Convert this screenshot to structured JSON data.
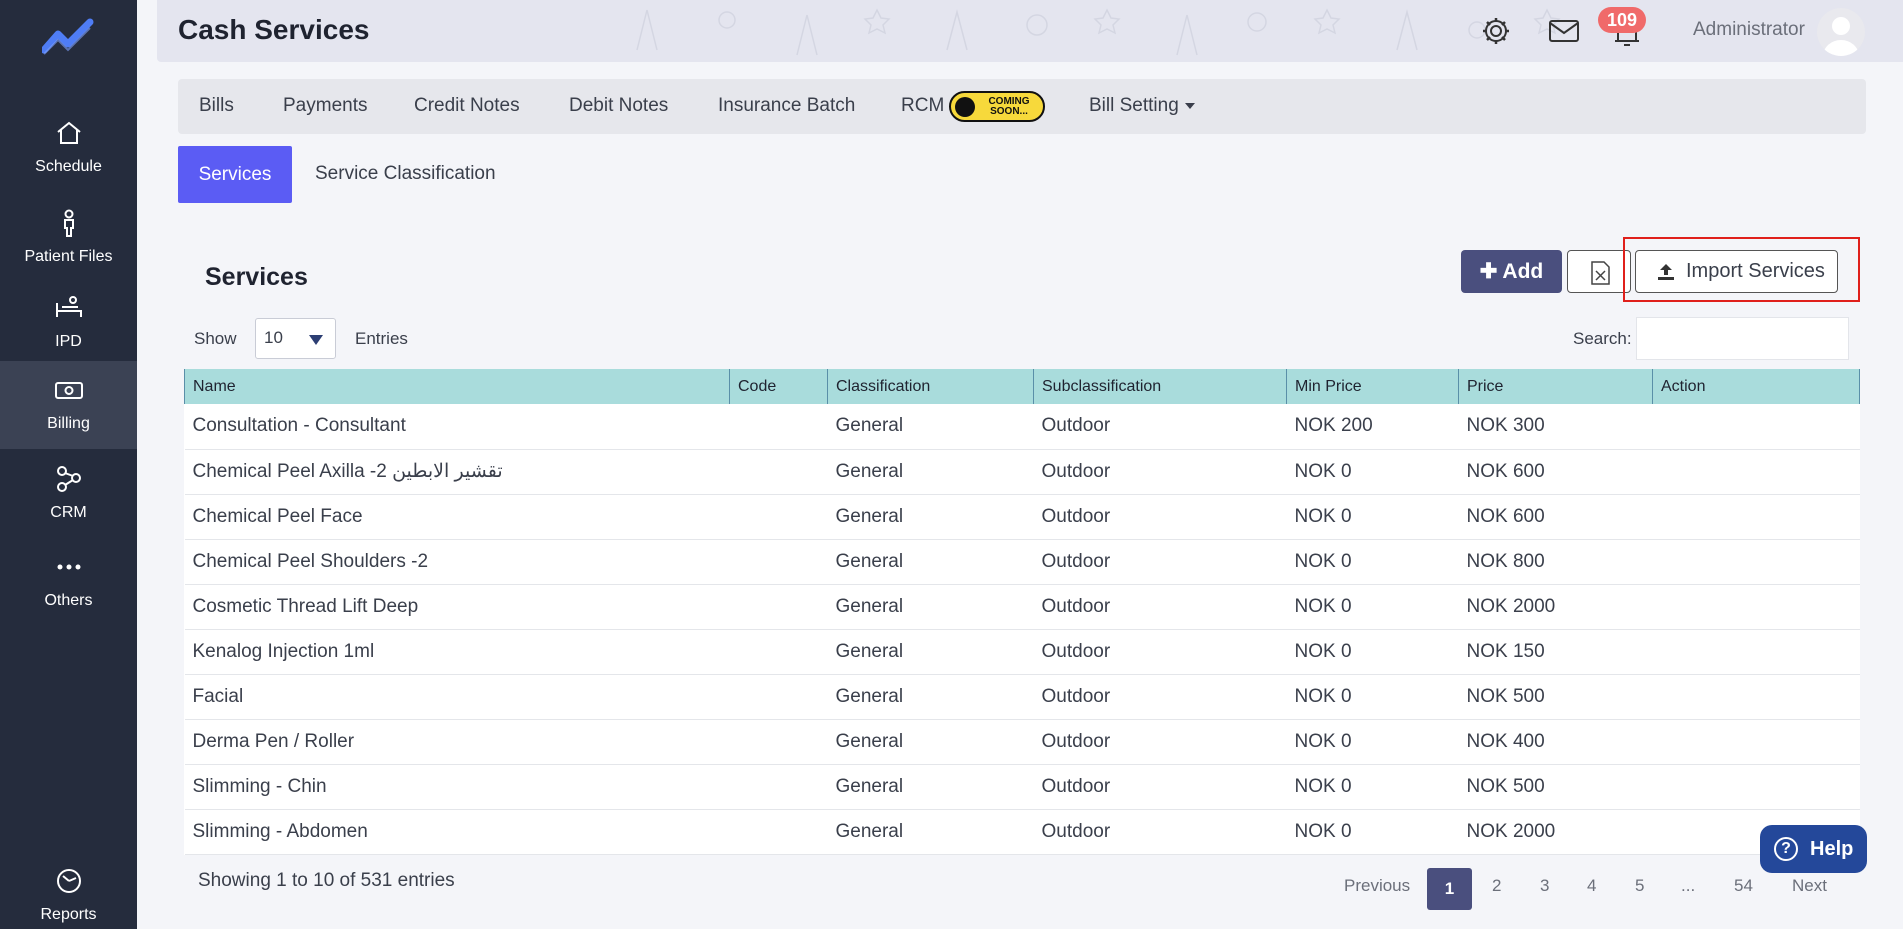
{
  "header": {
    "title": "Cash Services",
    "notification_count": "109",
    "user_name": "Administrator"
  },
  "sidebar": {
    "items": [
      {
        "label": "Schedule",
        "icon": "home-icon"
      },
      {
        "label": "Patient Files",
        "icon": "person-icon"
      },
      {
        "label": "IPD",
        "icon": "bed-icon"
      },
      {
        "label": "Billing",
        "icon": "money-icon"
      },
      {
        "label": "CRM",
        "icon": "network-icon"
      },
      {
        "label": "Others",
        "icon": "dots-icon"
      },
      {
        "label": "Reports",
        "icon": "chart-pie-icon"
      }
    ],
    "active": "Billing"
  },
  "tabs": {
    "bills": "Bills",
    "payments": "Payments",
    "credit_notes": "Credit Notes",
    "debit_notes": "Debit Notes",
    "insurance_batch": "Insurance Batch",
    "rcm": "RCM",
    "coming_soon_line1": "COMING",
    "coming_soon_line2": "SOON...",
    "bill_setting": "Bill Setting"
  },
  "subtabs": {
    "services": "Services",
    "service_classification": "Service Classification"
  },
  "section": {
    "title": "Services",
    "add_label": "Add",
    "import_label": "Import Services",
    "show_label": "Show",
    "entries_value": "10",
    "entries_label": "Entries",
    "search_label": "Search:",
    "search_value": ""
  },
  "table": {
    "columns": [
      "Name",
      "Code",
      "Classification",
      "Subclassification",
      "Min Price",
      "Price",
      "Action"
    ],
    "rows": [
      [
        "Consultation - Consultant",
        "",
        "General",
        "Outdoor",
        "NOK 200",
        "NOK 300",
        ""
      ],
      [
        "Chemical Peel Axilla -2 تقشير الابطين",
        "",
        "General",
        "Outdoor",
        "NOK 0",
        "NOK 600",
        ""
      ],
      [
        "Chemical Peel Face",
        "",
        "General",
        "Outdoor",
        "NOK 0",
        "NOK 600",
        ""
      ],
      [
        "Chemical Peel Shoulders -2",
        "",
        "General",
        "Outdoor",
        "NOK 0",
        "NOK 800",
        ""
      ],
      [
        "Cosmetic Thread Lift Deep",
        "",
        "General",
        "Outdoor",
        "NOK 0",
        "NOK 2000",
        ""
      ],
      [
        "Kenalog Injection 1ml",
        "",
        "General",
        "Outdoor",
        "NOK 0",
        "NOK 150",
        ""
      ],
      [
        "Facial",
        "",
        "General",
        "Outdoor",
        "NOK 0",
        "NOK 500",
        ""
      ],
      [
        "Derma Pen / Roller",
        "",
        "General",
        "Outdoor",
        "NOK 0",
        "NOK 400",
        ""
      ],
      [
        "Slimming - Chin",
        "",
        "General",
        "Outdoor",
        "NOK 0",
        "NOK 500",
        ""
      ],
      [
        "Slimming - Abdomen",
        "",
        "General",
        "Outdoor",
        "NOK 0",
        "NOK 2000",
        ""
      ]
    ]
  },
  "footer": {
    "showing": "Showing 1 to 10 of 531 entries",
    "previous": "Previous",
    "pages": [
      "1",
      "2",
      "3",
      "4",
      "5",
      "...",
      "54"
    ],
    "next": "Next",
    "help": "Help"
  },
  "colors": {
    "sidebar_bg": "#252c3d",
    "accent": "#5b5cf4",
    "primary_button": "#4a4f7e",
    "table_header": "#a9dcdc",
    "badge": "#f06a6a",
    "highlight": "#e0201b"
  }
}
